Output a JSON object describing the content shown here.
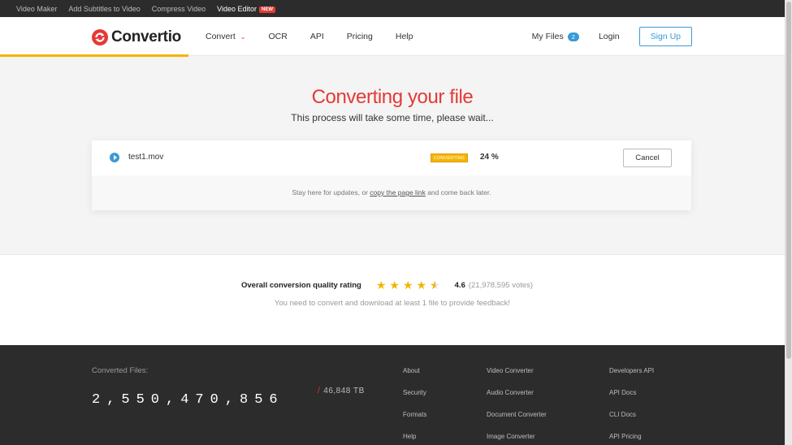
{
  "topbar": {
    "links": [
      {
        "label": "Video Maker"
      },
      {
        "label": "Add Subtitles to Video"
      },
      {
        "label": "Compress Video"
      },
      {
        "label": "Video Editor",
        "badge": "NEW"
      }
    ]
  },
  "header": {
    "logo_text": "Convertio",
    "nav": [
      {
        "label": "Convert"
      },
      {
        "label": "OCR"
      },
      {
        "label": "API"
      },
      {
        "label": "Pricing"
      },
      {
        "label": "Help"
      }
    ],
    "my_files_label": "My Files",
    "my_files_count": "2",
    "login_label": "Login",
    "signup_label": "Sign Up",
    "progress_fraction": 0.24
  },
  "main": {
    "title": "Converting your file",
    "subtitle": "This process will take some time, please wait...",
    "file": {
      "name": "test1.mov",
      "status": "CONVERTING",
      "percent": "24 %",
      "cancel_label": "Cancel"
    },
    "note_before": "Stay here for updates, or ",
    "note_link": "copy the page link",
    "note_after": " and come back later."
  },
  "rating": {
    "label": "Overall conversion quality rating",
    "stars_value": 4.6,
    "score": "4.6",
    "votes": "(21,978,595 votes)",
    "note": "You need to convert and download at least 1 file to provide feedback!"
  },
  "footer": {
    "converted_label": "Converted Files:",
    "converted_count": "2,550,470,856",
    "tb_slash": "/",
    "tb_value": "46,848 TB",
    "col1": [
      "About",
      "Security",
      "Formats",
      "Help"
    ],
    "col2": [
      "Video Converter",
      "Audio Converter",
      "Document Converter",
      "Image Converter"
    ],
    "col3": [
      "Developers API",
      "API Docs",
      "CLI Docs",
      "API Pricing"
    ]
  },
  "colors": {
    "brand_red": "#e53935",
    "accent_blue": "#3a9bd5",
    "status_yellow": "#f4b400",
    "footer_bg": "#2c2c2c"
  }
}
